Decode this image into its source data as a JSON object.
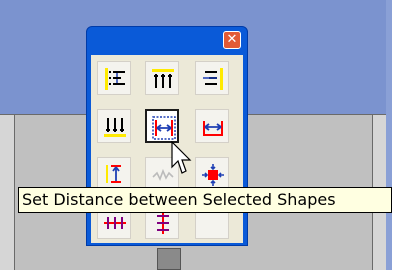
{
  "tooltip": {
    "text": "Set Distance between Selected Shapes"
  },
  "window": {
    "close_glyph": "✕"
  },
  "tools": [
    {
      "name": "align-left-tool",
      "icon": "align-left-icon"
    },
    {
      "name": "align-top-tool",
      "icon": "align-top-icon"
    },
    {
      "name": "align-right-tool",
      "icon": "align-right-icon"
    },
    {
      "name": "align-bottom-tool",
      "icon": "align-bottom-icon"
    },
    {
      "name": "set-distance-tool",
      "icon": "set-distance-icon",
      "selected": true
    },
    {
      "name": "distance-right-tool",
      "icon": "distance-icon"
    },
    {
      "name": "distance-vertical-tool",
      "icon": "distance-vertical-icon"
    },
    {
      "name": "disabled-tool",
      "icon": "disabled-icon",
      "disabled": true
    },
    {
      "name": "expand-tool",
      "icon": "expand-icon"
    },
    {
      "name": "distribute-horizontal-tool",
      "icon": "distribute-horizontal-icon"
    },
    {
      "name": "distribute-vertical-tool",
      "icon": "distribute-vertical-icon"
    },
    {
      "name": "empty-tool",
      "icon": "blank"
    }
  ],
  "colors": {
    "window_blue": "#0a5ad8",
    "accent_red": "#ff0000",
    "accent_blue": "#1e3fb4",
    "accent_yellow": "#ffea00"
  }
}
